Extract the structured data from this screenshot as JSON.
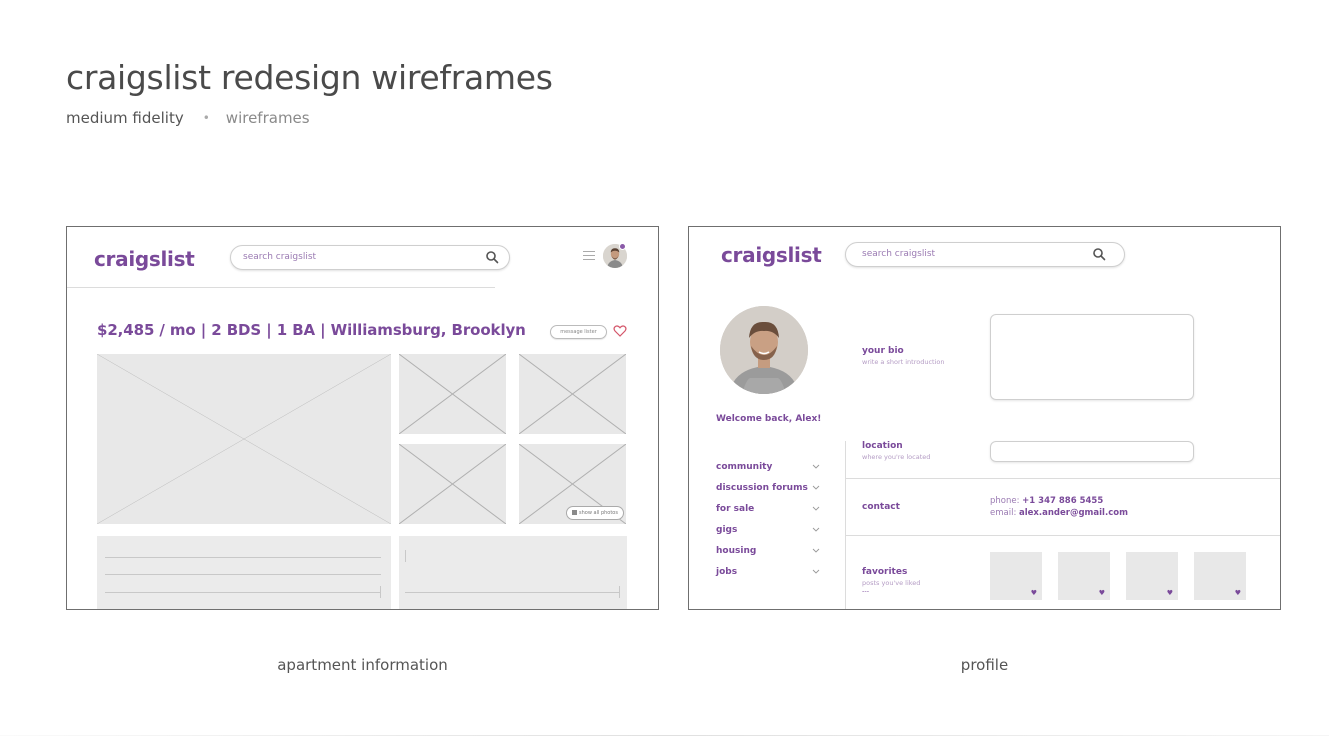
{
  "page": {
    "title": "craigslist redesign wireframes",
    "subtitle_left": "medium fidelity",
    "subtitle_separator": "•",
    "subtitle_right": "wireframes"
  },
  "apartment": {
    "caption": "apartment information",
    "logo": "craigslist",
    "search_placeholder": "search craigslist",
    "listing_title": "$2,485 / mo | 2 BDS | 1 BA | Williamsburg, Brooklyn",
    "message_button": "message lister",
    "show_photos_button": "show all photos"
  },
  "profile": {
    "caption": "profile",
    "logo": "craigslist",
    "search_placeholder": "search craigslist",
    "welcome": "Welcome back, Alex!",
    "nav_items": [
      "community",
      "discussion forums",
      "for sale",
      "gigs",
      "housing",
      "jobs"
    ],
    "bio_label": "your bio",
    "bio_hint": "write a short introduction",
    "location_label": "location",
    "location_hint": "where you're located",
    "contact_label": "contact",
    "phone_prefix": "phone: ",
    "phone_value": "+1 347 886 5455",
    "email_prefix": "email: ",
    "email_value": "alex.ander@gmail.com",
    "favorites_label": "favorites",
    "favorites_hint": "posts you've liked",
    "favorites_more": "---",
    "favorite_heart": "♥"
  },
  "colors": {
    "brand_purple": "#7a4a9a",
    "placeholder_gray": "#e8e8e8"
  }
}
